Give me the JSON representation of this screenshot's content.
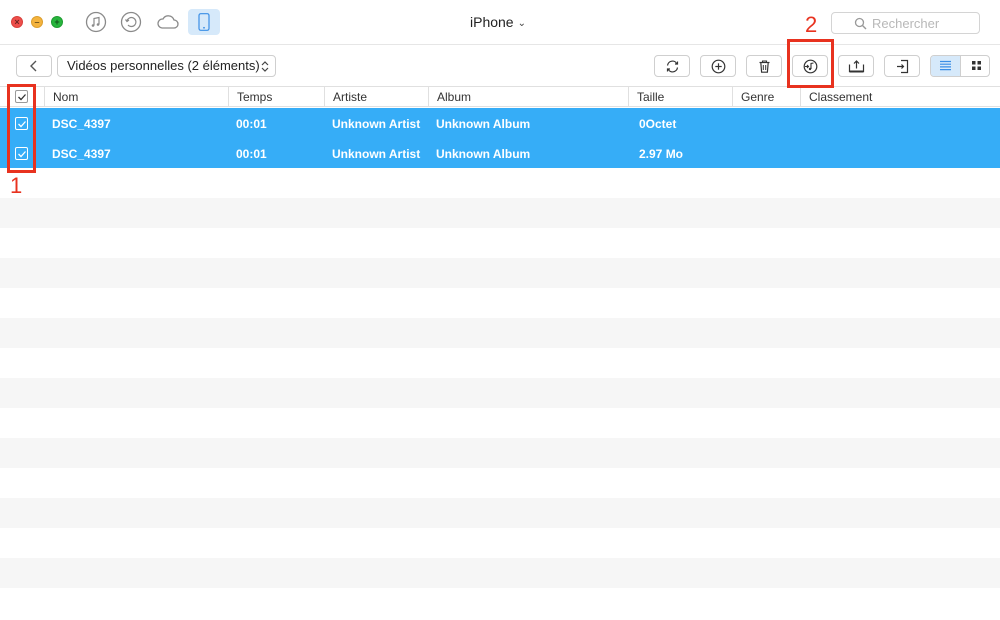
{
  "titlebar": {
    "device_name": "iPhone",
    "search_placeholder": "Rechercher"
  },
  "nav_icons": [
    "itunes-music-icon",
    "restore-history-icon",
    "icloud-icon",
    "iphone-device-icon"
  ],
  "toolbar": {
    "category": "Vidéos personnelles (2 éléments)",
    "buttons": [
      "refresh-icon",
      "add-icon",
      "delete-icon",
      "to-itunes-icon",
      "to-computer-icon",
      "to-device-icon"
    ],
    "view_modes": [
      "list-view-icon",
      "grid-view-icon"
    ],
    "active_view": "list"
  },
  "table": {
    "columns": [
      "Nom",
      "Temps",
      "Artiste",
      "Album",
      "Taille",
      "Genre",
      "Classement"
    ],
    "rows": [
      {
        "checked": true,
        "name": "DSC_4397",
        "time": "00:01",
        "artist": "Unknown Artist",
        "album": "Unknown Album",
        "size": "0Octet",
        "genre": "",
        "rating": ""
      },
      {
        "checked": true,
        "name": "DSC_4397",
        "time": "00:01",
        "artist": "Unknown Artist",
        "album": "Unknown Album",
        "size": "2.97 Mo",
        "genre": "",
        "rating": ""
      }
    ]
  },
  "annotations": [
    "1",
    "2"
  ],
  "colors": {
    "selection": "#36adf7",
    "annotation": "#e8321f",
    "active_tab": "#d6e9fa"
  }
}
